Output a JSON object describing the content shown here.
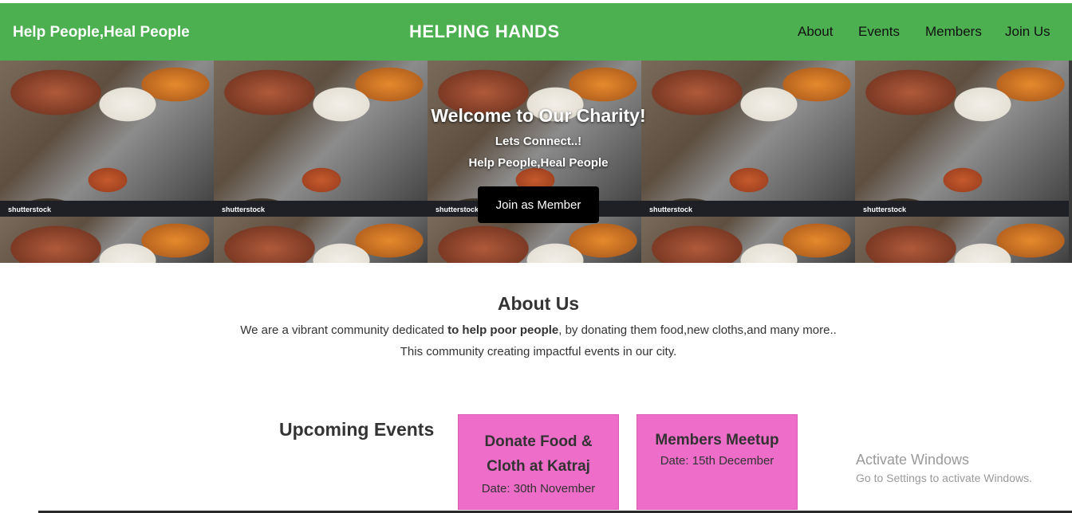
{
  "navbar": {
    "tagline": "Help People,Heal People",
    "brand": "HELPING HANDS",
    "links": [
      "About",
      "Events",
      "Members",
      "Join Us"
    ],
    "background_color": "#4caf50"
  },
  "hero": {
    "title": "Welcome to Our Charity!",
    "subtitle1": "Lets Connect..!",
    "subtitle2": "Help People,Heal People",
    "button_label": "Join as Member",
    "watermark": "shutterstock"
  },
  "about": {
    "title": "About Us",
    "line1_pre": "We are a vibrant community dedicated ",
    "line1_bold": "to help poor people",
    "line1_post": ", by donating them food,new cloths,and many more..",
    "line2": "This community creating impactful events in our city."
  },
  "events": {
    "title": "Upcoming Events",
    "card_color": "#ee6dc8",
    "items": [
      {
        "name": "Donate Food & Cloth at Katraj",
        "date": "Date: 30th November"
      },
      {
        "name": "Members Meetup",
        "date": "Date: 15th December"
      }
    ]
  },
  "overlay": {
    "activate_title": "Activate Windows",
    "activate_sub": "Go to Settings to activate Windows."
  }
}
